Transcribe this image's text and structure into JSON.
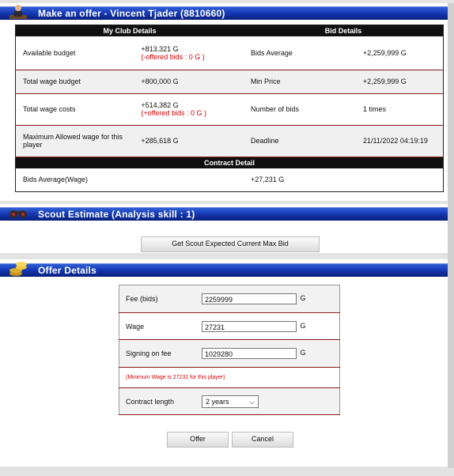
{
  "offer_header": {
    "title": "Make an offer - Vincent Tjader (8810660)"
  },
  "bid_table": {
    "my_club_header": "My Club Details",
    "bid_details_header": "Bid Details",
    "rows": [
      {
        "label": "Available budget",
        "value": "+813,321 G",
        "sub": "(-offered bids : 0 G )",
        "right_label": "Bids Average",
        "right_value": "+2,259,999 G"
      },
      {
        "label": "Total wage budget",
        "value": "+800,000 G",
        "sub": "",
        "right_label": "Min Price",
        "right_value": "+2,259,999 G"
      },
      {
        "label": "Total wage costs",
        "value": "+514,382 G",
        "sub": "(+offered bids : 0 G )",
        "right_label": "Number of bids",
        "right_value": "1 times"
      },
      {
        "label": "Maximum Allowed wage for this player",
        "value": "+285,618 G",
        "sub": "",
        "right_label": "Deadline",
        "right_value": "21/11/2022 04:19:19"
      }
    ],
    "contract_header": "Contract Detail",
    "contract_row": {
      "label": "Bids Average(Wage)",
      "value": "+27,231 G"
    }
  },
  "scout_header": {
    "title": "Scout Estimate (Analysis skill : 1)"
  },
  "scout_button": "Get Scout Expected Current Max Bid",
  "offer_details_header": {
    "title": "Offer Details"
  },
  "offer_form": {
    "fee_label": "Fee (bids)",
    "fee_value": "2259999",
    "fee_unit": "G",
    "wage_label": "Wage",
    "wage_value": "27231",
    "wage_unit": "G",
    "signing_label": "Signing on fee",
    "signing_value": "1029280",
    "signing_unit": "G",
    "min_wage_note": "(Minimum Wage is 27231 for this player)",
    "contract_label": "Contract length",
    "contract_value": "2 years"
  },
  "buttons": {
    "offer": "Offer",
    "cancel": "Cancel"
  },
  "colors": {
    "header_blue": "#1437b0",
    "accent_red": "#d00000",
    "row_divider": "#8a1818"
  }
}
